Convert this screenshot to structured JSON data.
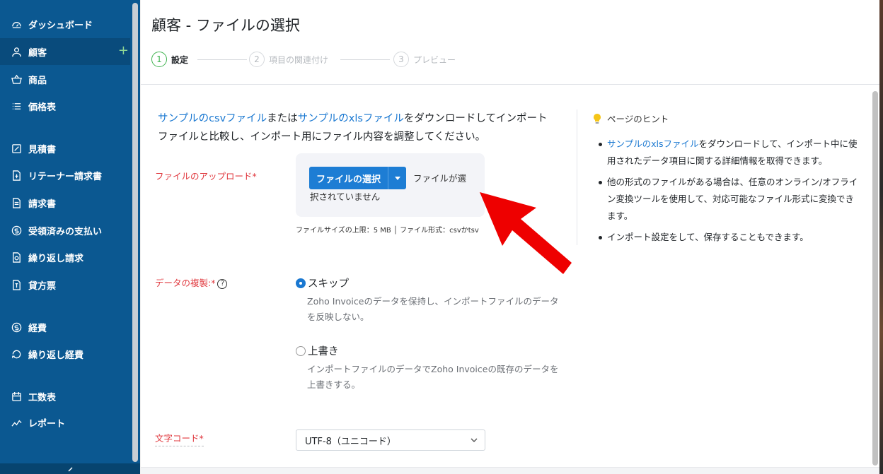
{
  "sidebar": {
    "items": [
      {
        "label": "ダッシュボード",
        "icon": "dashboard-icon"
      },
      {
        "label": "顧客",
        "icon": "user-icon",
        "active": true
      },
      {
        "label": "商品",
        "icon": "basket-icon"
      },
      {
        "label": "価格表",
        "icon": "list-icon"
      },
      {
        "label": "見積書",
        "icon": "estimate-icon"
      },
      {
        "label": "リテーナー請求書",
        "icon": "retainer-icon"
      },
      {
        "label": "請求書",
        "icon": "invoice-icon"
      },
      {
        "label": "受領済みの支払い",
        "icon": "payment-icon"
      },
      {
        "label": "繰り返し請求",
        "icon": "recurring-invoice-icon"
      },
      {
        "label": "貸方票",
        "icon": "credit-note-icon"
      },
      {
        "label": "経費",
        "icon": "expense-icon"
      },
      {
        "label": "繰り返し経費",
        "icon": "recurring-expense-icon"
      },
      {
        "label": "工数表",
        "icon": "timesheet-icon"
      },
      {
        "label": "レポート",
        "icon": "report-icon"
      }
    ],
    "add_symbol": "+"
  },
  "page": {
    "title": "顧客 - ファイルの選択",
    "steps": [
      {
        "number": "1",
        "label": "設定",
        "active": true
      },
      {
        "number": "2",
        "label": "項目の関連付け",
        "active": false
      },
      {
        "number": "3",
        "label": "プレビュー",
        "active": false
      }
    ]
  },
  "intro": {
    "link_csv": "サンプルのcsvファイル",
    "text_or": "または",
    "link_xls": "サンプルのxlsファイル",
    "text_rest": "をダウンロードしてインポートファイルと比較し、インポート用にファイル内容を調整してください。"
  },
  "upload": {
    "label": "ファイルのアップロード*",
    "button_label": "ファイルの選択",
    "no_file_line1": "ファイルが選",
    "no_file_line2": "択されていません",
    "file_info": "ファイルサイズの上限：5 MB │ ファイル形式：csvかtsv"
  },
  "duplicates": {
    "label": "データの複製:*",
    "help": "?",
    "options": [
      {
        "label": "スキップ",
        "checked": true,
        "description": "Zoho Invoiceのデータを保持し、インポートファイルのデータを反映しない。"
      },
      {
        "label": "上書き",
        "checked": false,
        "description": "インポートファイルのデータでZoho Invoiceの既存のデータを上書きする。"
      }
    ]
  },
  "encoding": {
    "label": "文字コード*",
    "selected": "UTF-8（ユニコード）"
  },
  "hints": {
    "title": "ページのヒント",
    "items": [
      {
        "link": "サンプルのxlsファイル",
        "text": "をダウンロードして、インポート中に使用されたデータ項目に関する詳細情報を取得できます。"
      },
      {
        "link": "",
        "text": "他の形式のファイルがある場合は、任意のオンライン/オフライン変換ツールを使用して、対応可能なファイル形式に変換できます。"
      },
      {
        "link": "",
        "text": "インポート設定をして、保存することもできます。"
      }
    ]
  },
  "colors": {
    "sidebar": "#0b5891",
    "accent": "#1d7dd4",
    "required": "#e0383e",
    "step_active": "#3fb34f",
    "annotation_arrow": "#ee0000"
  }
}
